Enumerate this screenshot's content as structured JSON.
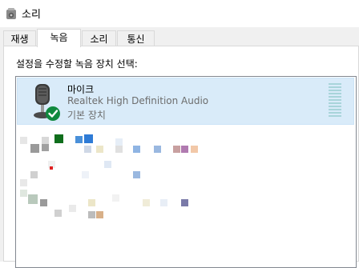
{
  "window": {
    "title": "소리",
    "icon": "speaker-icon"
  },
  "tabs": [
    {
      "label": "재생",
      "active": false
    },
    {
      "label": "녹음",
      "active": true
    },
    {
      "label": "소리",
      "active": false
    },
    {
      "label": "통신",
      "active": false
    }
  ],
  "panel": {
    "instruction": "설정을 수정할 녹음 장치 선택:"
  },
  "devices": [
    {
      "name": "마이크",
      "driver": "Realtek High Definition Audio",
      "status": "기본 장치",
      "icon": "microphone-icon",
      "badge_icon": "default-device-check-icon",
      "selected": true
    }
  ],
  "colors": {
    "selected_row": "#d9ebf9",
    "check_badge": "#10893e",
    "level_meter": "#a8d4da"
  }
}
